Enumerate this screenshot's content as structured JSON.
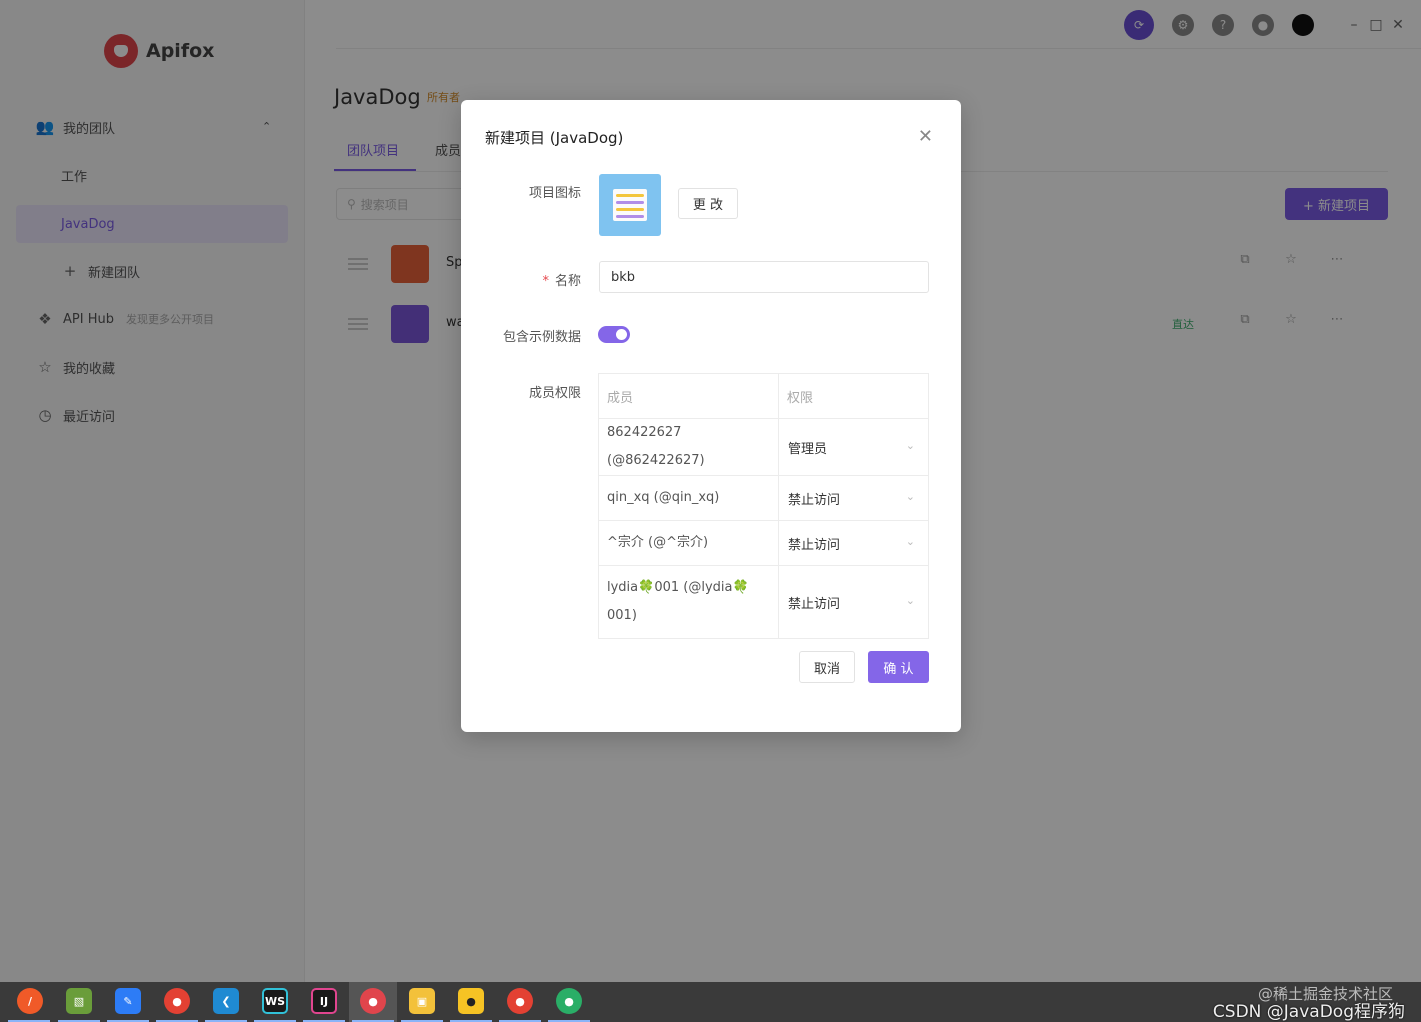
{
  "app": {
    "logo_text": "Apifox",
    "sidebar": {
      "my_team": "我的团队",
      "team_work": "工作",
      "team_javadog": "JavaDog",
      "new_team": "新建团队",
      "api_hub": "API Hub",
      "api_hub_hint": "发现更多公开项目",
      "favorites": "我的收藏",
      "recent": "最近访问"
    },
    "header": {
      "team_title": "JavaDog",
      "owner_badge": "所有者"
    },
    "tabs": [
      {
        "label": "团队项目"
      },
      {
        "label": "成员"
      }
    ],
    "search_placeholder": "搜索项目",
    "new_project_button": "+ 新建项目",
    "projects": [
      {
        "name": "Sp",
        "thumb_color": "#e8623a"
      },
      {
        "name": "wa",
        "thumb_color": "#7b57d9",
        "tag": "直达"
      }
    ]
  },
  "modal": {
    "title": "新建项目 (JavaDog)",
    "icon_label": "项目图标",
    "change_button": "更 改",
    "name_label": "名称",
    "name_value": "bkb",
    "sample_data_label": "包含示例数据",
    "sample_data_enabled": true,
    "permission_label": "成员权限",
    "table": {
      "col_member": "成员",
      "col_permission": "权限",
      "rows": [
        {
          "member": "862422627 (@862422627)",
          "permission": "管理员"
        },
        {
          "member": "qin_xq (@qin_xq)",
          "permission": "禁止访问"
        },
        {
          "member": "^宗介 (@^宗介)",
          "permission": "禁止访问"
        },
        {
          "member": "lydia🍀001 (@lydia🍀001)",
          "permission": "禁止访问"
        }
      ]
    },
    "cancel_button": "取消",
    "confirm_button": "确 认"
  },
  "watermark": {
    "line1": "@稀土掘金技术社区",
    "line2": "CSDN @JavaDog程序狗"
  },
  "colors": {
    "accent": "#7a5ce6",
    "toggle": "#8466e8",
    "danger": "#e5484d"
  }
}
